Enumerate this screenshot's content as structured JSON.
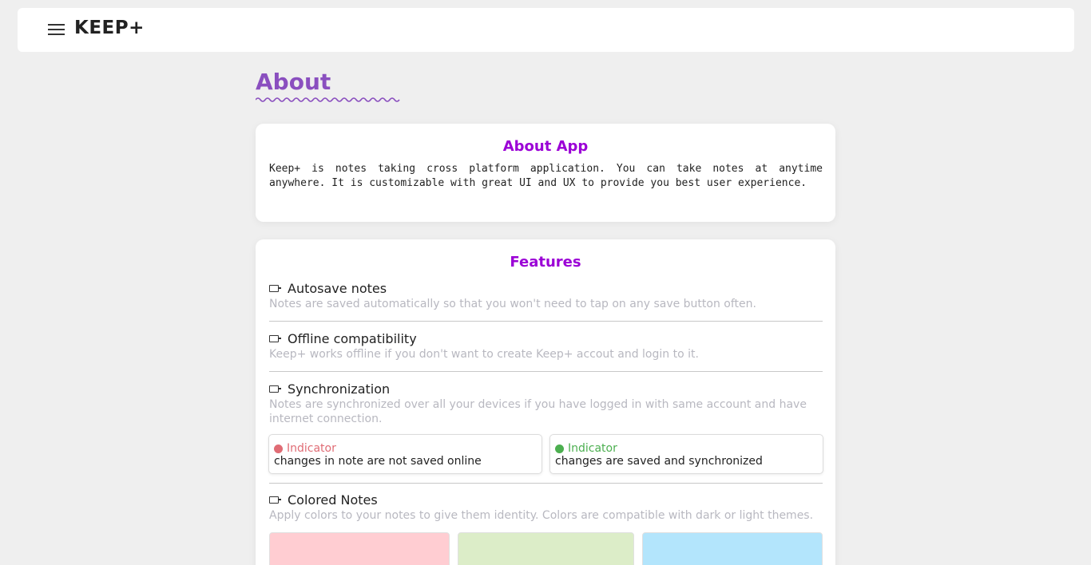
{
  "header": {
    "brand": "KEEP+"
  },
  "page": {
    "title": "About"
  },
  "about_card": {
    "title": "About App",
    "text": "Keep+ is notes taking cross platform application. You can take notes at anytime anywhere. It is customizable with great UI and UX to provide you best user experience."
  },
  "features_card": {
    "title": "Features",
    "items": [
      {
        "name": "Autosave notes",
        "description": "Notes are saved automatically so that you won't need to tap on any save button often."
      },
      {
        "name": "Offline compatibility",
        "description": "Keep+ works offline if you don't want to create Keep+ accout and login to it."
      },
      {
        "name": "Synchronization",
        "description": "Notes are synchronized over all your devices if you have logged in with same account and have internet connection."
      },
      {
        "name": "Colored Notes",
        "description": "Apply colors to your notes to give them identity. Colors are compatible with dark or light themes."
      }
    ],
    "indicators": [
      {
        "label": "Indicator",
        "description": "changes in note are not saved online",
        "color": "#e06c75"
      },
      {
        "label": "Indicator",
        "description": "changes are saved and synchronized",
        "color": "#4caf50"
      }
    ],
    "swatches": [
      "#ffcdd2",
      "#dcedc8",
      "#b3e5fc"
    ]
  },
  "colors": {
    "accent": "#9b00d6",
    "title": "#8a4fbf",
    "background": "#efefef"
  }
}
